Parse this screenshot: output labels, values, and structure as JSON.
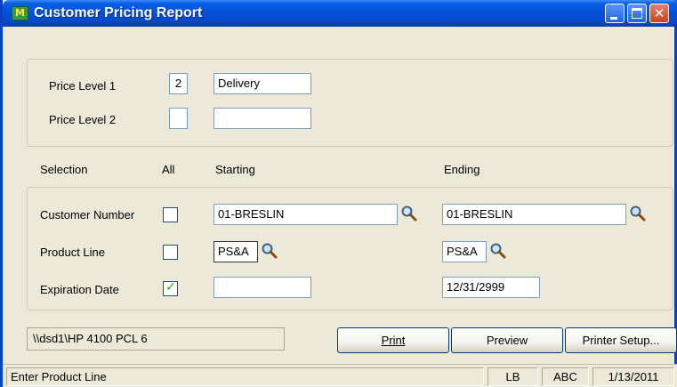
{
  "window": {
    "title": "Customer Pricing Report",
    "app_icon_text": "M"
  },
  "price_levels": {
    "level1_label": "Price Level 1",
    "level1_code": "2",
    "level1_desc": "Delivery",
    "level2_label": "Price Level 2",
    "level2_code": "",
    "level2_desc": ""
  },
  "selection": {
    "header_selection": "Selection",
    "header_all": "All",
    "header_starting": "Starting",
    "header_ending": "Ending",
    "rows": [
      {
        "label": "Customer Number",
        "all_checked": false,
        "starting": "01-BRESLIN",
        "ending": "01-BRESLIN"
      },
      {
        "label": "Product Line",
        "all_checked": false,
        "starting": "PS&A",
        "ending": "PS&A"
      },
      {
        "label": "Expiration Date",
        "all_checked": true,
        "starting": "",
        "ending": "12/31/2999"
      }
    ]
  },
  "printer": {
    "name": "\\\\dsd1\\HP 4100 PCL 6"
  },
  "buttons": {
    "print": "Print",
    "preview": "Preview",
    "printer_setup": "Printer Setup..."
  },
  "status": {
    "message": "Enter Product Line",
    "user": "LB",
    "company": "ABC",
    "date": "1/13/2011"
  },
  "colors": {
    "title_bar": "#0450d6",
    "check": "#21a121"
  },
  "icons": [
    "lookup-magnifier-icon",
    "checkmark-icon",
    "minimize-icon",
    "maximize-icon",
    "close-icon"
  ]
}
